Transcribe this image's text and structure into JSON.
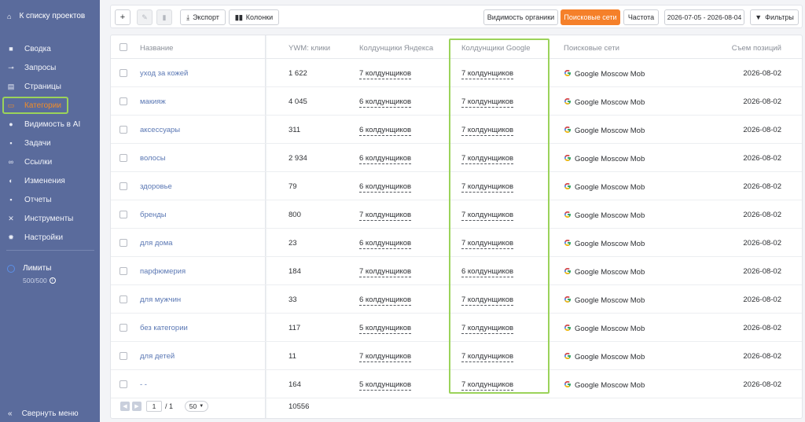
{
  "sidebar": {
    "back_label": "К списку проектов",
    "items": [
      {
        "label": "Сводка",
        "icon": "grid-icon",
        "glyph": "■"
      },
      {
        "label": "Запросы",
        "icon": "key-icon",
        "glyph": "⊸"
      },
      {
        "label": "Страницы",
        "icon": "page-icon",
        "glyph": "▤"
      },
      {
        "label": "Категории",
        "icon": "folder-icon",
        "glyph": "▭",
        "active": true
      },
      {
        "label": "Видимость в AI",
        "icon": "bulb-icon",
        "glyph": "●"
      },
      {
        "label": "Задачи",
        "icon": "task-icon",
        "glyph": "▪"
      },
      {
        "label": "Ссылки",
        "icon": "link-icon",
        "glyph": "∞"
      },
      {
        "label": "Изменения",
        "icon": "changes-icon",
        "glyph": "◐"
      },
      {
        "label": "Отчеты",
        "icon": "report-icon",
        "glyph": "▪"
      },
      {
        "label": "Инструменты",
        "icon": "tools-icon",
        "glyph": "✕"
      },
      {
        "label": "Настройки",
        "icon": "gear-icon",
        "glyph": "✹"
      }
    ],
    "limits_label": "Лимиты",
    "limits_value": "500/500",
    "collapse_label": "Свернуть меню"
  },
  "toolbar": {
    "add": "+",
    "export": "Экспорт",
    "columns": "Колонки",
    "organic_visibility": "Видимость органики",
    "search_networks": "Поисковые сети",
    "frequency": "Частота",
    "date_range": "2026-07-05 - 2026-08-04",
    "filters": "Фильтры"
  },
  "colors": {
    "accent": "#f5802a",
    "sidebar": "#5a6b9c",
    "highlight": "#9bd35a",
    "link": "#5b78b4"
  },
  "table": {
    "headers": {
      "name": "Название",
      "ywm": "YWM: клики",
      "yandex": "Колдунщики Яндекса",
      "google": "Колдунщики Google",
      "networks": "Поисковые сети",
      "snapshot": "Съем позиций"
    },
    "rows": [
      {
        "name": "уход за кожей",
        "ywm": "1 622",
        "yandex": "7 колдунщиков",
        "google": "7 колдунщиков",
        "network": "Google Moscow Mob",
        "date": "2026-08-02"
      },
      {
        "name": "макияж",
        "ywm": "4 045",
        "yandex": "6 колдунщиков",
        "google": "7 колдунщиков",
        "network": "Google Moscow Mob",
        "date": "2026-08-02"
      },
      {
        "name": "аксессуары",
        "ywm": "311",
        "yandex": "6 колдунщиков",
        "google": "7 колдунщиков",
        "network": "Google Moscow Mob",
        "date": "2026-08-02"
      },
      {
        "name": "волосы",
        "ywm": "2 934",
        "yandex": "6 колдунщиков",
        "google": "7 колдунщиков",
        "network": "Google Moscow Mob",
        "date": "2026-08-02"
      },
      {
        "name": "здоровье",
        "ywm": "79",
        "yandex": "6 колдунщиков",
        "google": "7 колдунщиков",
        "network": "Google Moscow Mob",
        "date": "2026-08-02"
      },
      {
        "name": "бренды",
        "ywm": "800",
        "yandex": "7 колдунщиков",
        "google": "7 колдунщиков",
        "network": "Google Moscow Mob",
        "date": "2026-08-02"
      },
      {
        "name": "для дома",
        "ywm": "23",
        "yandex": "6 колдунщиков",
        "google": "7 колдунщиков",
        "network": "Google Moscow Mob",
        "date": "2026-08-02"
      },
      {
        "name": "парфюмерия",
        "ywm": "184",
        "yandex": "7 колдунщиков",
        "google": "6 колдунщиков",
        "network": "Google Moscow Mob",
        "date": "2026-08-02"
      },
      {
        "name": "для мужчин",
        "ywm": "33",
        "yandex": "6 колдунщиков",
        "google": "7 колдунщиков",
        "network": "Google Moscow Mob",
        "date": "2026-08-02"
      },
      {
        "name": "без категории",
        "ywm": "117",
        "yandex": "5 колдунщиков",
        "google": "7 колдунщиков",
        "network": "Google Moscow Mob",
        "date": "2026-08-02"
      },
      {
        "name": "для детей",
        "ywm": "11",
        "yandex": "7 колдунщиков",
        "google": "7 колдунщиков",
        "network": "Google Moscow Mob",
        "date": "2026-08-02"
      },
      {
        "name": "- -",
        "ywm": "164",
        "yandex": "5 колдунщиков",
        "google": "7 колдунщиков",
        "network": "Google Moscow Mob",
        "date": "2026-08-02"
      }
    ]
  },
  "footer": {
    "page": "1",
    "of": "/ 1",
    "page_size": "50",
    "total": "10556"
  }
}
